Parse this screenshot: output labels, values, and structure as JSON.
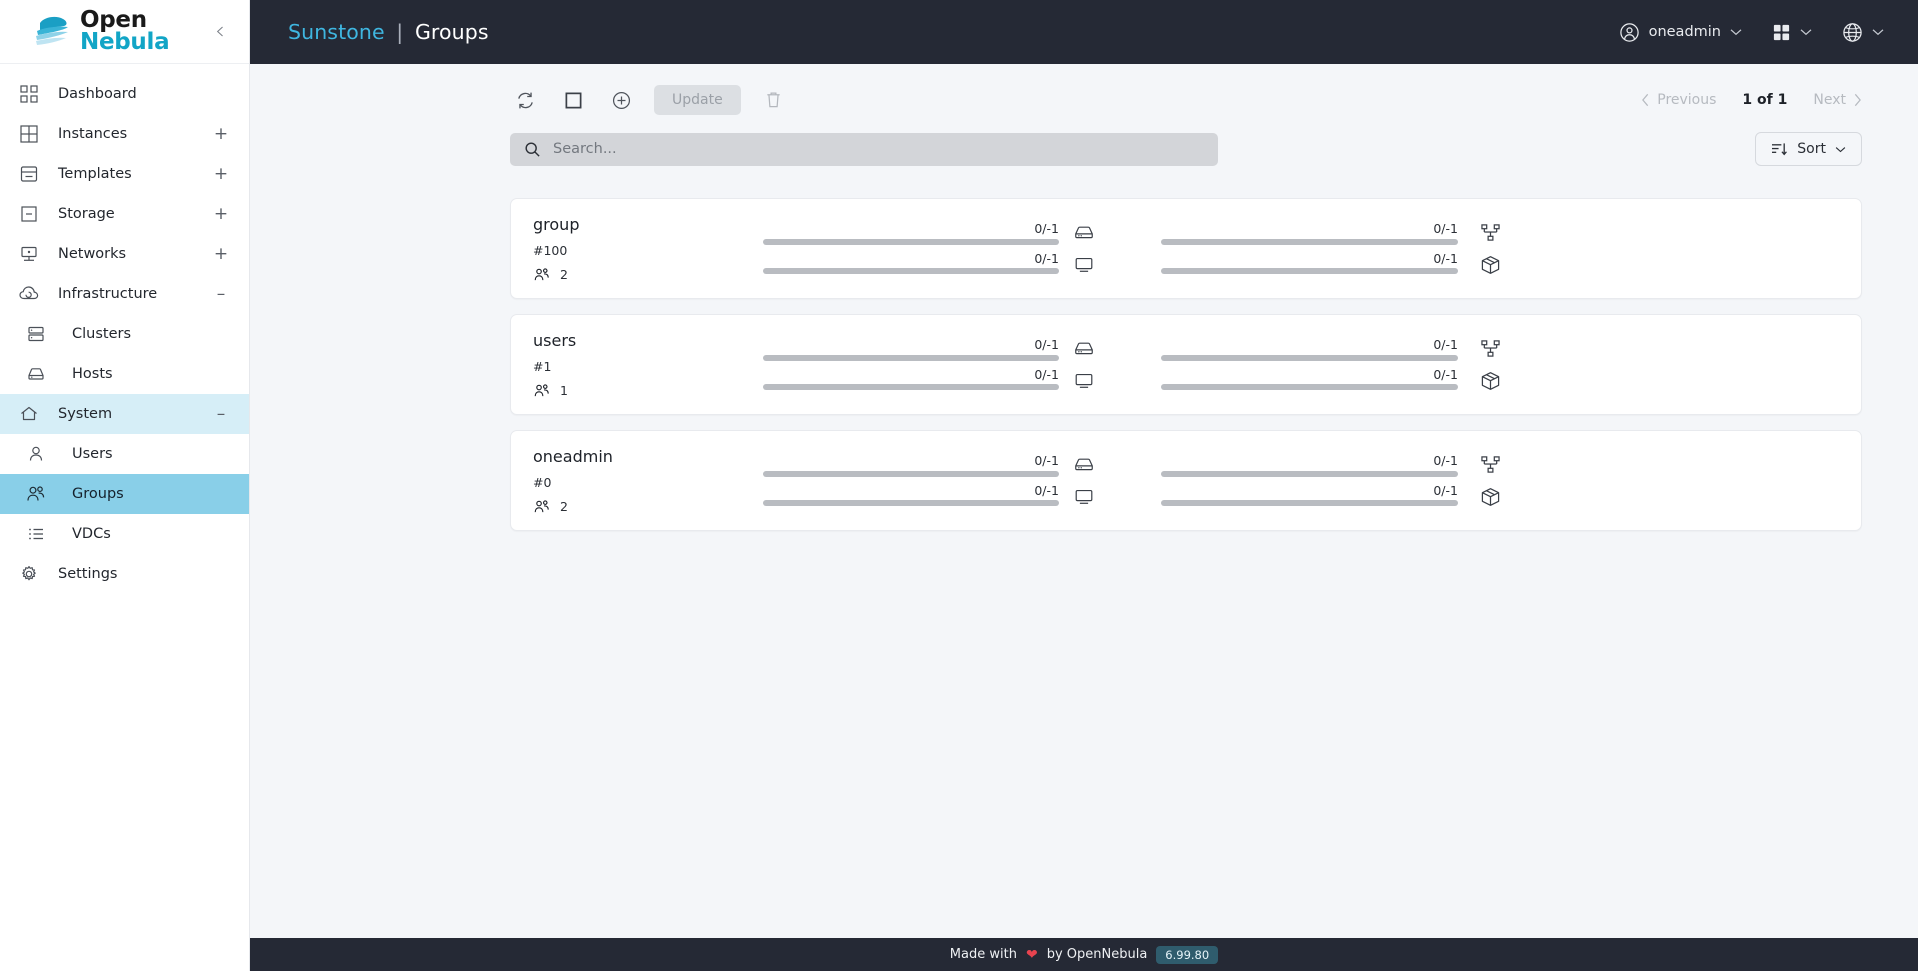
{
  "brand": {
    "logo_line1": "Open",
    "logo_line2": "Nebula",
    "collapse_icon": "chevron-left-icon"
  },
  "sidebar": {
    "items": [
      {
        "label": "Dashboard",
        "icon": "dashboard-grid-icon",
        "level": 0,
        "expander": "",
        "state": ""
      },
      {
        "label": "Instances",
        "icon": "instances-grid-icon",
        "level": 0,
        "expander": "+",
        "state": ""
      },
      {
        "label": "Templates",
        "icon": "templates-icon",
        "level": 0,
        "expander": "+",
        "state": ""
      },
      {
        "label": "Storage",
        "icon": "storage-icon",
        "level": 0,
        "expander": "+",
        "state": ""
      },
      {
        "label": "Networks",
        "icon": "networks-icon",
        "level": 0,
        "expander": "+",
        "state": ""
      },
      {
        "label": "Infrastructure",
        "icon": "cloud-icon",
        "level": 0,
        "expander": "–",
        "state": ""
      },
      {
        "label": "Clusters",
        "icon": "clusters-icon",
        "level": 1,
        "expander": "",
        "state": ""
      },
      {
        "label": "Hosts",
        "icon": "host-icon",
        "level": 1,
        "expander": "",
        "state": ""
      },
      {
        "label": "System",
        "icon": "home-icon",
        "level": 0,
        "expander": "–",
        "state": "active-parent"
      },
      {
        "label": "Users",
        "icon": "user-icon",
        "level": 1,
        "expander": "",
        "state": ""
      },
      {
        "label": "Groups",
        "icon": "users-icon",
        "level": 1,
        "expander": "",
        "state": "active"
      },
      {
        "label": "VDCs",
        "icon": "list-icon",
        "level": 1,
        "expander": "",
        "state": ""
      },
      {
        "label": "Settings",
        "icon": "gear-icon",
        "level": 0,
        "expander": "",
        "state": ""
      }
    ]
  },
  "topbar": {
    "app_name": "Sunstone",
    "separator": "|",
    "page_name": "Groups",
    "user": "oneadmin",
    "user_icon": "user-circle-icon",
    "apps_icon": "apps-grid-icon",
    "language_icon": "globe-icon"
  },
  "toolbar": {
    "refresh_icon": "refresh-icon",
    "select_all_icon": "checkbox-empty-icon",
    "create_icon": "plus-circle-icon",
    "update_label": "Update",
    "delete_icon": "trash-icon"
  },
  "pagination": {
    "previous_label": "Previous",
    "count_label": "1 of 1",
    "next_label": "Next"
  },
  "search": {
    "placeholder": "Search...",
    "value": "",
    "icon": "search-icon"
  },
  "sort": {
    "label": "Sort",
    "icon": "sort-descending-icon",
    "chevron": "chevron-down-icon"
  },
  "groups": [
    {
      "name": "group",
      "id": "#100",
      "users_count": "2",
      "users_icon": "users-icon",
      "quotas": [
        {
          "icon": "host-drive-icon",
          "value": "0/-1",
          "percent": 0
        },
        {
          "icon": "monitor-vm-icon",
          "value": "0/-1",
          "percent": 0
        },
        {
          "icon": "network-tree-icon",
          "value": "0/-1",
          "percent": 0
        },
        {
          "icon": "package-box-icon",
          "value": "0/-1",
          "percent": 0
        }
      ]
    },
    {
      "name": "users",
      "id": "#1",
      "users_count": "1",
      "users_icon": "users-icon",
      "quotas": [
        {
          "icon": "host-drive-icon",
          "value": "0/-1",
          "percent": 0
        },
        {
          "icon": "monitor-vm-icon",
          "value": "0/-1",
          "percent": 0
        },
        {
          "icon": "network-tree-icon",
          "value": "0/-1",
          "percent": 0
        },
        {
          "icon": "package-box-icon",
          "value": "0/-1",
          "percent": 0
        }
      ]
    },
    {
      "name": "oneadmin",
      "id": "#0",
      "users_count": "2",
      "users_icon": "users-icon",
      "quotas": [
        {
          "icon": "host-drive-icon",
          "value": "0/-1",
          "percent": 0
        },
        {
          "icon": "monitor-vm-icon",
          "value": "0/-1",
          "percent": 0
        },
        {
          "icon": "network-tree-icon",
          "value": "0/-1",
          "percent": 0
        },
        {
          "icon": "package-box-icon",
          "value": "0/-1",
          "percent": 0
        }
      ]
    }
  ],
  "footer": {
    "made_with": "Made with",
    "heart": "❤",
    "by": "by OpenNebula",
    "version": "6.99.80"
  },
  "colors": {
    "accent_cyan": "#3fb6e0",
    "topbar_bg": "#252935",
    "active_nav": "#89cfe8",
    "active_parent_nav": "#d6eef7",
    "bar_track": "#b9bcc1",
    "heart_red": "#e8434f",
    "version_badge": "#2f5c6d"
  }
}
